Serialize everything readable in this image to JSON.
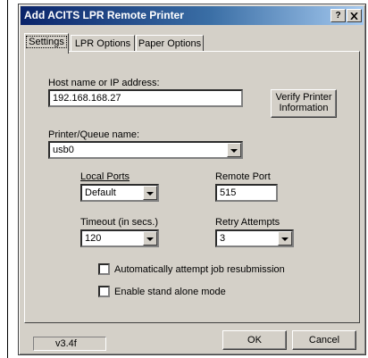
{
  "window": {
    "title": "Add ACITS LPR Remote Printer",
    "help_label": "?",
    "close_label": "X"
  },
  "tabs": [
    {
      "label": "Settings",
      "active": true
    },
    {
      "label": "LPR Options",
      "active": false
    },
    {
      "label": "Paper Options",
      "active": false
    }
  ],
  "settings": {
    "host_label": "Host name or IP address:",
    "host_value": "192.168.168.27",
    "verify_label_1": "Verify Printer",
    "verify_label_2": "Information",
    "queue_label": "Printer/Queue name:",
    "queue_value": "usb0",
    "local_ports_label": "Local Ports",
    "local_ports_value": "Default",
    "remote_port_label": "Remote Port",
    "remote_port_value": "515",
    "timeout_label": "Timeout (in secs.)",
    "timeout_value": "120",
    "retry_label": "Retry Attempts",
    "retry_value": "3",
    "auto_resubmit_label": "Automatically attempt job resubmission",
    "auto_resubmit_checked": false,
    "standalone_label": "Enable stand alone mode",
    "standalone_checked": false
  },
  "footer": {
    "version": "v3.4f",
    "ok_label": "OK",
    "cancel_label": "Cancel"
  }
}
